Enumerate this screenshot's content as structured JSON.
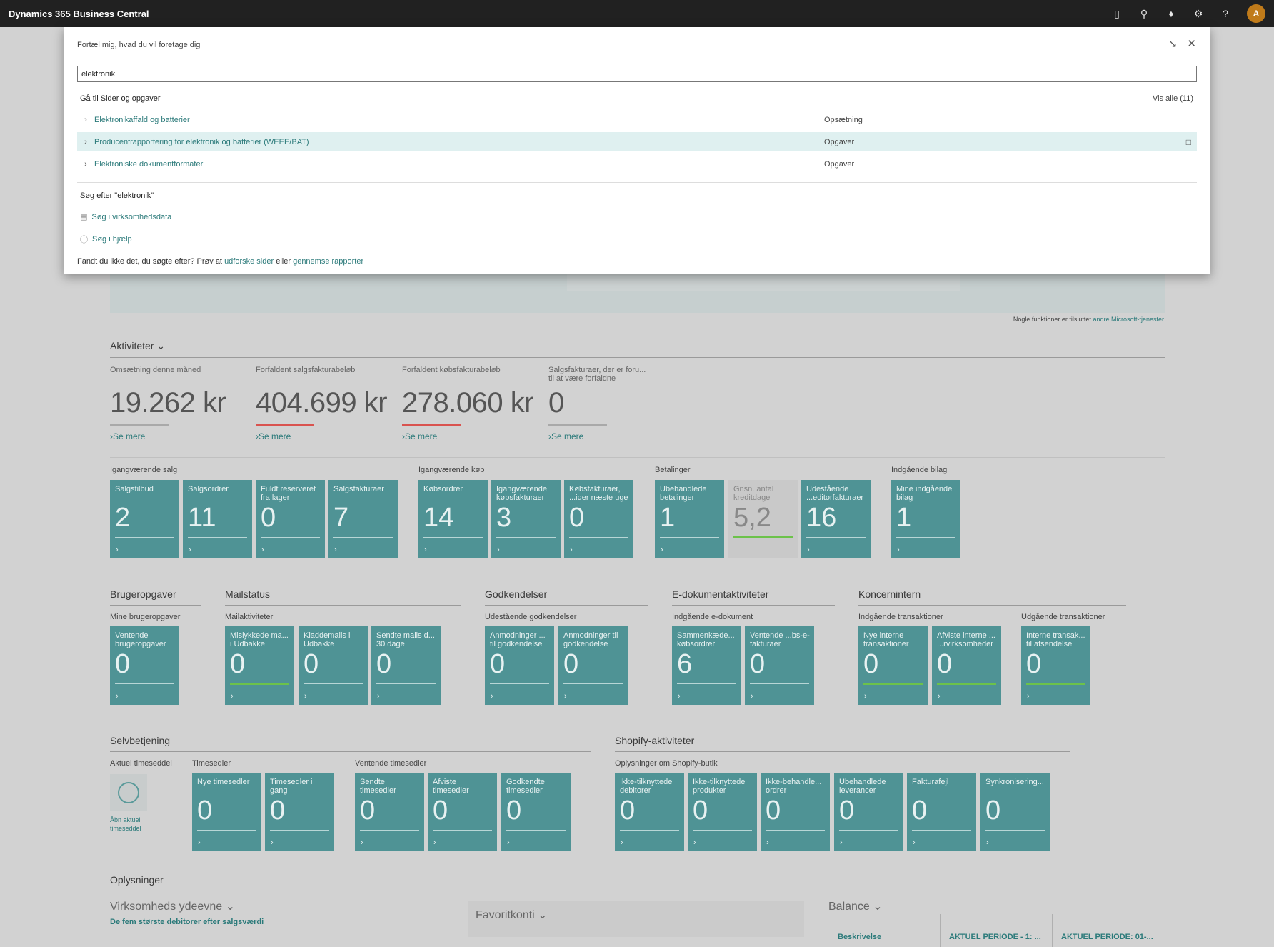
{
  "app": {
    "title": "Dynamics 365 Business Central",
    "avatar_initial": "A"
  },
  "topbar_icons": [
    "document-icon",
    "search-icon",
    "bell-icon",
    "gear-icon",
    "help-icon"
  ],
  "dialog": {
    "prompt": "Fortæl mig, hvad du vil foretage dig",
    "search_value": "elektronik",
    "section_pages": "Gå til Sider og opgaver",
    "show_all": "Vis alle (11)",
    "results": [
      {
        "title": "Elektronikaffald og batterier",
        "category": "Opsætning"
      },
      {
        "title": "Producentrapportering for elektronik og batterier (WEEE/BAT)",
        "category": "Opgaver"
      },
      {
        "title": "Elektroniske dokumentformater",
        "category": "Opgaver"
      }
    ],
    "section_search": "Søg efter \"elektronik\"",
    "search_company": "Søg i virksomhedsdata",
    "search_help": "Søg i hjælp",
    "footer_prefix": "Fandt du ikke det, du søgte efter? Prøv at",
    "footer_link1": "udforske sider",
    "footer_mid": "eller",
    "footer_link2": "gennemse rapporter"
  },
  "hero": {
    "note_prefix": "Nogle funktioner er tilsluttet",
    "note_link": "andre Microsoft-tjenester"
  },
  "activities": {
    "title": "Aktiviteter",
    "kpis": [
      {
        "label": "Omsætning denne måned",
        "value": "19.262 kr",
        "more": "Se mere",
        "bar_color": "#a9a9a9"
      },
      {
        "label": "Forfaldent salgsfakturabeløb",
        "value": "404.699 kr",
        "more": "Se mere",
        "bar_color": "#d9534f"
      },
      {
        "label": "Forfaldent købsfakturabeløb",
        "value": "278.060 kr",
        "more": "Se mere",
        "bar_color": "#d9534f"
      },
      {
        "label": "Salgsfakturaer, der er foru... til at være forfaldne",
        "value": "0",
        "more": "Se mere",
        "bar_color": "#a9a9a9"
      }
    ]
  },
  "groups": {
    "igang_salg": "Igangværende salg",
    "igang_koeb": "Igangværende køb",
    "betalinger": "Betalinger",
    "indgaaende_bilag": "Indgående bilag"
  },
  "tiles_row1": [
    {
      "label": "Salgstilbud",
      "value": "2"
    },
    {
      "label": "Salgsordrer",
      "value": "11"
    },
    {
      "label": "Fuldt reserveret fra lager",
      "value": "0"
    },
    {
      "label": "Salgsfakturaer",
      "value": "7"
    },
    {
      "label": "Købsordrer",
      "value": "14"
    },
    {
      "label": "Igangværende købsfakturaer",
      "value": "3"
    },
    {
      "label": "Købsfakturaer, ...ider næste uge",
      "value": "0"
    },
    {
      "label": "Ubehandlede betalinger",
      "value": "1"
    },
    {
      "label": "Gnsn. antal kreditdage",
      "value": "5,2"
    },
    {
      "label": "Udestående ...editorfakturaer",
      "value": "16"
    },
    {
      "label": "Mine indgående bilag",
      "value": "1"
    }
  ],
  "sections_row2": {
    "brugeropgaver": "Brugeropgaver",
    "mine_brugeropgaver": "Mine brugeropgaver",
    "mailstatus": "Mailstatus",
    "mailaktiviteter": "Mailaktiviteter",
    "godkendelser": "Godkendelser",
    "udestaaende_godkendelser": "Udestående godkendelser",
    "edok": "E-dokumentaktiviteter",
    "indg_edok": "Indgående e-dokument",
    "koncernintern": "Koncernintern",
    "indg_trans": "Indgående transaktioner",
    "udg_trans": "Udgående transaktioner"
  },
  "tiles_row2": [
    {
      "label": "Ventende brugeropgaver",
      "value": "0"
    },
    {
      "label": "Mislykkede ma... i Udbakke",
      "value": "0"
    },
    {
      "label": "Kladdemails i Udbakke",
      "value": "0"
    },
    {
      "label": "Sendte mails d... 30 dage",
      "value": "0"
    },
    {
      "label": "Anmodninger ... til godkendelse",
      "value": "0"
    },
    {
      "label": "Anmodninger til godkendelse",
      "value": "0"
    },
    {
      "label": "Sammenkæde... købsordrer",
      "value": "6"
    },
    {
      "label": "Ventende ...bs-e-fakturaer",
      "value": "0"
    },
    {
      "label": "Nye interne transaktioner",
      "value": "0"
    },
    {
      "label": "Afviste interne ... ...rvirksomheder",
      "value": "0"
    },
    {
      "label": "Interne transak... til afsendelse",
      "value": "0"
    }
  ],
  "sections_row3": {
    "selvbetjening": "Selvbetjening",
    "aktuel_timeseddel": "Aktuel timeseddel",
    "open_timesheet": "Åbn aktuel timeseddel",
    "timesedler": "Timesedler",
    "ventende_timesedler": "Ventende timesedler",
    "shopify": "Shopify-aktiviteter",
    "shopify_info": "Oplysninger om Shopify-butik"
  },
  "tiles_row3": [
    {
      "label": "Nye timesedler",
      "value": "0"
    },
    {
      "label": "Timesedler i gang",
      "value": "0"
    },
    {
      "label": "Sendte timesedler",
      "value": "0"
    },
    {
      "label": "Afviste timesedler",
      "value": "0"
    },
    {
      "label": "Godkendte timesedler",
      "value": "0"
    },
    {
      "label": "Ikke-tilknyttede debitorer",
      "value": "0"
    },
    {
      "label": "Ikke-tilknyttede produkter",
      "value": "0"
    },
    {
      "label": "Ikke-behandle... ordrer",
      "value": "0"
    },
    {
      "label": "Ubehandlede leverancer",
      "value": "0"
    },
    {
      "label": "Fakturafejl",
      "value": "0"
    },
    {
      "label": "Synkronisering...",
      "value": "0"
    }
  ],
  "info": {
    "title": "Oplysninger",
    "company_perf": "Virksomheds ydeevne",
    "top5": "De fem største debitorer efter salgsværdi",
    "favorites": "Favoritkonti",
    "balance": "Balance",
    "col_desc": "Beskrivelse",
    "col_period1": "AKTUEL PERIODE - 1: ...",
    "col_period2": "AKTUEL PERIODE: 01-..."
  }
}
